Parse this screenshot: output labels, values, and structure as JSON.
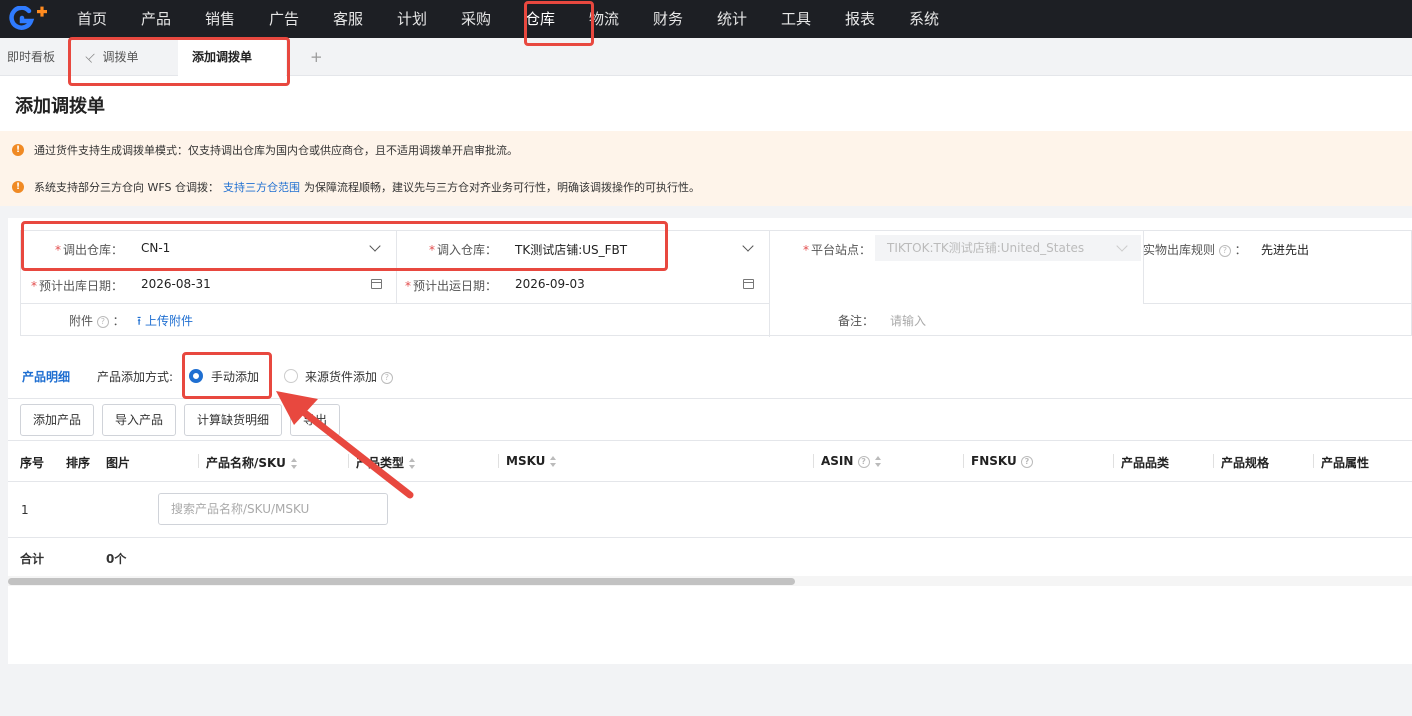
{
  "nav": {
    "items": [
      "首页",
      "产品",
      "销售",
      "广告",
      "客服",
      "计划",
      "采购",
      "仓库",
      "物流",
      "财务",
      "统计",
      "工具",
      "报表",
      "系统"
    ],
    "active_index": 7
  },
  "tabs": {
    "dashboard": "即时看板",
    "transfer_list": "调拨单",
    "add_transfer": "添加调拨单",
    "add": "+"
  },
  "page": {
    "title": "添加调拨单"
  },
  "alerts": {
    "line1": "通过货件支持生成调拨单模式：仅支持调出仓库为国内仓或供应商仓，且不适用调拨单开启审批流。",
    "line2_before": "系统支持部分三方仓向 WFS 仓调拨：",
    "line2_link": "支持三方仓范围",
    "line2_after": "为保障流程顺畅，建议先与三方仓对齐业务可行性，明确该调拨操作的可执行性。"
  },
  "form": {
    "out_warehouse_label": "调出仓库：",
    "out_warehouse_value": "CN-1",
    "in_warehouse_label": "调入仓库：",
    "in_warehouse_value": "TK测试店铺:US_FBT",
    "platform_label": "平台站点：",
    "platform_value": "TIKTOK:TK测试店铺:United_States",
    "outbound_rule_label": "实物出库规则",
    "outbound_rule_value": "先进先出",
    "expected_out_date_label": "预计出库日期：",
    "expected_out_date_value": "2026-08-31",
    "expected_ship_date_label": "预计出运日期：",
    "expected_ship_date_value": "2026-09-03",
    "attachment_label": "附件",
    "attachment_sep": "：",
    "upload_label": "上传附件",
    "remark_label": "备注：",
    "remark_placeholder": "请输入"
  },
  "products": {
    "tab_label": "产品明细",
    "mode_label": "产品添加方式:",
    "mode_manual": "手动添加",
    "mode_source": "来源货件添加",
    "selected_mode": "手动添加",
    "buttons": {
      "add": "添加产品",
      "import": "导入产品",
      "calc": "计算缺货明细",
      "export": "导出"
    },
    "columns": [
      "序号",
      "排序",
      "图片",
      "产品名称/SKU",
      "产品类型",
      "MSKU",
      "ASIN",
      "FNSKU",
      "产品品类",
      "产品规格",
      "产品属性"
    ],
    "rows": [
      {
        "index": "1",
        "search_placeholder": "搜索产品名称/SKU/MSKU"
      }
    ],
    "total_label": "合计",
    "total_value": "0个"
  }
}
